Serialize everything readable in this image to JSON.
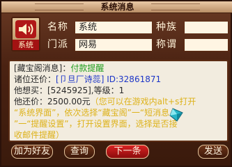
{
  "window": {
    "title": "系统消息"
  },
  "sender": {
    "icon_name": "speaker-icon",
    "tag": "系统",
    "fields": [
      {
        "label": "名称",
        "value": "系统"
      },
      {
        "label": "种族",
        "value": ""
      },
      {
        "label": "门派",
        "value": "网易"
      },
      {
        "label": "称谓",
        "value": ""
      }
    ]
  },
  "message": {
    "line1_prefix": "[藏宝阁消息]：",
    "line1_green": "付款提醒",
    "line2_label": "诸位还价：",
    "line2_name": "[卩旦厂诗蕊]",
    "line2_id": "ID:32861871",
    "line3_text": "他想买：[5245925],等级：1",
    "line4_label": "他还价：",
    "line4_price": "2500.00元",
    "line4_tip": "（您可以在游戏内alt+s打开",
    "tip_line2": "“系统界面”，依次选择“藏宝阁”一“短消息",
    "tip_line3": "”一“提醒设置”，打开设置界面，选择是否接",
    "tip_line4": "收邮件提醒）"
  },
  "buttons": {
    "add_friend": "加为好友",
    "query": "查询",
    "next": "下一条",
    "send": "发送"
  },
  "colors": {
    "accent_red": "#b01818",
    "green": "#1e9e1e",
    "blue": "#1d36c8",
    "yellow": "#ddb21a"
  }
}
